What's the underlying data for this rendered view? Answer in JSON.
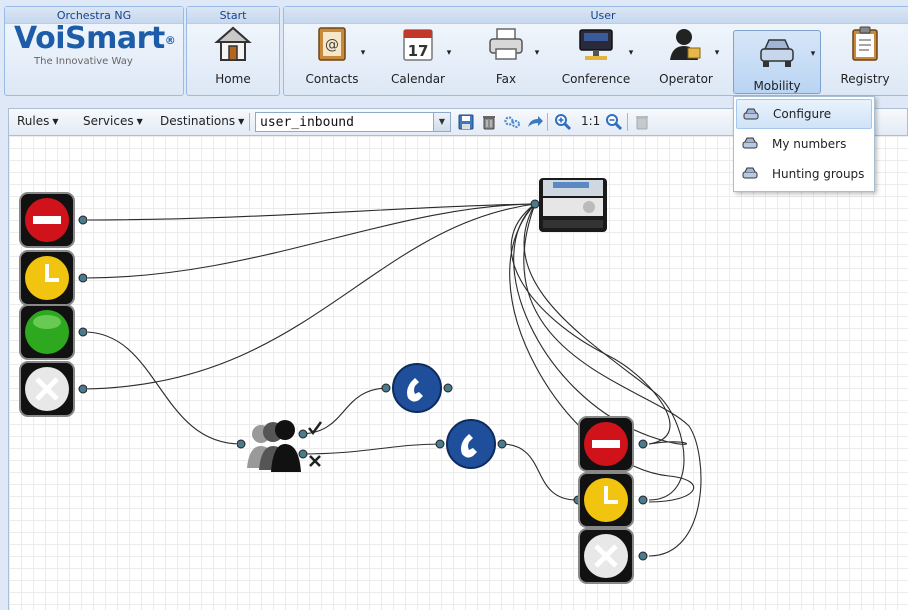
{
  "ribbon": {
    "groups": {
      "orchestra": "Orchestra NG",
      "start": "Start",
      "user": "User"
    },
    "logo": {
      "word": "VoiSmart",
      "mark": "®",
      "tagline": "The Innovative Way"
    },
    "buttons": {
      "home": "Home",
      "contacts": "Contacts",
      "calendar": "Calendar",
      "calendar_day": "17",
      "fax": "Fax",
      "conference": "Conference",
      "operator": "Operator",
      "mobility": "Mobility",
      "registry": "Registry"
    }
  },
  "mobility_menu": {
    "items": [
      "Configure",
      "My numbers",
      "Hunting groups"
    ]
  },
  "toolbar": {
    "rules": "Rules",
    "services": "Services",
    "destinations": "Destinations",
    "ruleset_value": "user_inbound",
    "zoom_reset": "1:1"
  },
  "canvas": {
    "nodes": [
      {
        "name": "deny-signal-node",
        "icon": "no-entry-icon"
      },
      {
        "name": "time-signal-node",
        "icon": "clock-icon"
      },
      {
        "name": "allow-signal-node",
        "icon": "green-light-icon"
      },
      {
        "name": "reject-signal-node",
        "icon": "x-icon"
      },
      {
        "name": "desk-phone-node",
        "icon": "desk-phone-icon"
      },
      {
        "name": "hunting-group-node",
        "icon": "group-icon"
      },
      {
        "name": "call-node-1",
        "icon": "phone-icon"
      },
      {
        "name": "call-node-2",
        "icon": "phone-icon"
      },
      {
        "name": "deny-signal-node-2",
        "icon": "no-entry-icon"
      },
      {
        "name": "time-signal-node-2",
        "icon": "clock-icon"
      },
      {
        "name": "reject-signal-node-2",
        "icon": "x-icon"
      }
    ],
    "colors": {
      "wire": "#2b2b2b",
      "port": "#4a7a8c",
      "phone_blue": "#1f4f9a",
      "red": "#d0121a",
      "yellow": "#f1c40f",
      "green": "#2ea81e"
    }
  }
}
